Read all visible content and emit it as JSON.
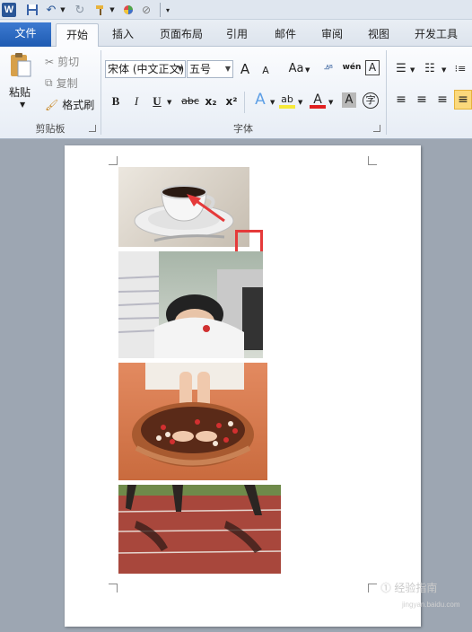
{
  "quick_access": {
    "app_icon": "word-app-icon",
    "save_icon": "save-icon",
    "undo_icon": "undo-icon",
    "redo_icon": "redo-icon",
    "format_icon": "format-painter-icon",
    "color_icon": "color-wheel-icon",
    "clear_icon": "clear-format-icon",
    "customize_icon": "customize-dropdown-icon"
  },
  "tabs": {
    "file": "文件",
    "home": "开始",
    "insert": "插入",
    "layout": "页面布局",
    "references": "引用",
    "mailings": "邮件",
    "review": "审阅",
    "view": "视图",
    "developer": "开发工具"
  },
  "clipboard": {
    "paste": "粘贴",
    "cut": "剪切",
    "copy": "复制",
    "format_painter": "格式刷",
    "group_label": "剪贴板"
  },
  "font": {
    "font_name": "宋体 (中文正文)",
    "font_size": "五号",
    "grow": "A",
    "shrink": "A",
    "change_case": "Aa",
    "bold": "B",
    "italic": "I",
    "underline": "U",
    "strike": "abc",
    "subscript": "x₂",
    "superscript": "x²",
    "text_effect": "A",
    "highlight": "ab",
    "font_color": "A",
    "char_shading": "A",
    "enclosed_char": "字",
    "phonetic": "wén",
    "group_label": "字体"
  },
  "watermark": {
    "text": "⓵ 经验指南",
    "sub": "jingyan.baidu.com"
  },
  "colors": {
    "accent": "#1e5bb2",
    "highlight_red": "#e53a3a",
    "page_bg": "#ffffff",
    "workspace_bg": "#9da6b2"
  }
}
